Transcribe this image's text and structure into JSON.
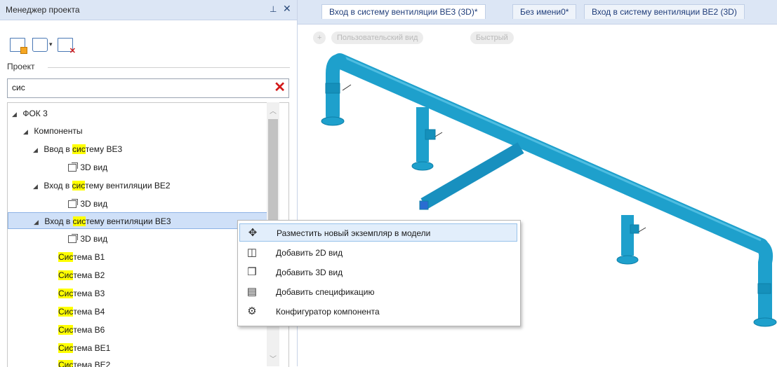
{
  "panel": {
    "title": "Менеджер проекта",
    "pin_icon": "pin-icon",
    "close_glyph": "✕"
  },
  "toolbar": {
    "icons": [
      "new-component-icon",
      "open-folder-icon",
      "dropdown-arrow-icon",
      "delete-component-icon"
    ]
  },
  "section_label": "Проект",
  "search": {
    "value": "сис",
    "clear_icon": "clear-icon",
    "clear_color": "#d21a1a"
  },
  "tree": {
    "root": "ФОК 3",
    "components_label": "Компоненты",
    "node1_pre": "Ввод в ",
    "node1_hl": "сис",
    "node1_post": "тему ВЕ3",
    "node1_child": "3D вид",
    "node2_pre": "Вход в ",
    "node2_hl": "сис",
    "node2_post": "тему вентиляции ВЕ2",
    "node2_child": "3D вид",
    "node3_pre": "Вход в ",
    "node3_hl": "сис",
    "node3_post": "тему вентиляции ВЕ3",
    "node3_child": "3D вид",
    "systems": [
      {
        "hl": "Сис",
        "post": "тема В1"
      },
      {
        "hl": "Сис",
        "post": "тема В2"
      },
      {
        "hl": "Сис",
        "post": "тема В3"
      },
      {
        "hl": "Сис",
        "post": "тема В4"
      },
      {
        "hl": "Сис",
        "post": "тема В6"
      },
      {
        "hl": "Сис",
        "post": "тема ВЕ1"
      },
      {
        "hl": "Сис",
        "post": "тема ВЕ2"
      }
    ]
  },
  "tabs": [
    {
      "label": "Вход в систему вентиляции ВЕ3 (3D)*"
    },
    {
      "label": "Без имени0*"
    },
    {
      "label": "Вход в систему вентиляции ВЕ2 (3D)"
    }
  ],
  "view_buttons": {
    "plus": "+",
    "custom": "Пользовательский вид",
    "fast": "Быстрый"
  },
  "context_menu": {
    "items": [
      {
        "label": "Разместить новый экземпляр в модели",
        "icon": "puzzle-icon"
      },
      {
        "label": "Добавить 2D вид",
        "icon": "2d-view-icon"
      },
      {
        "label": "Добавить 3D вид",
        "icon": "cube-icon"
      },
      {
        "label": "Добавить спецификацию",
        "icon": "specification-icon"
      },
      {
        "label": "Конфигуратор компонента",
        "icon": "gear-icon"
      }
    ]
  },
  "colors": {
    "pipe": "#1ea0cc",
    "pipe_dark": "#0d7fa8",
    "highlight": "#ffff00",
    "accent": "#1f3d7a"
  }
}
